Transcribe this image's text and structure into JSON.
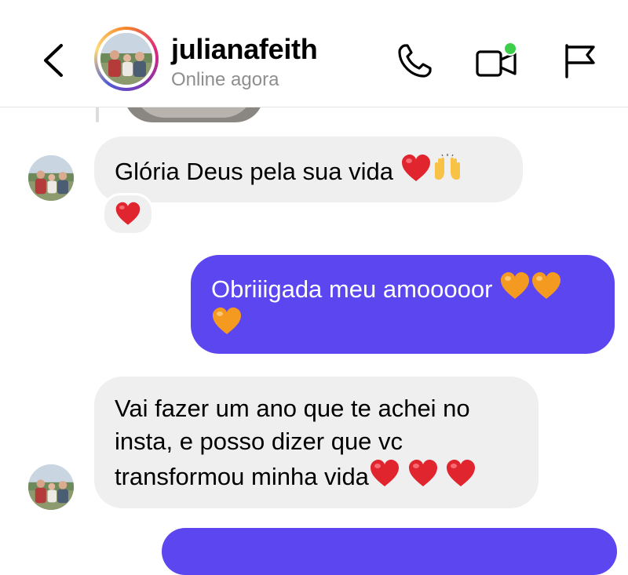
{
  "header": {
    "username": "julianafeith",
    "status": "Online agora",
    "icons": {
      "back": "back-chevron-icon",
      "call": "phone-icon",
      "video": "video-camera-icon",
      "report": "flag-icon"
    }
  },
  "messages": [
    {
      "direction": "incoming",
      "text": "Glória Deus pela sua vida",
      "emojis": [
        "red-heart",
        "raising-hands"
      ],
      "reaction": "red-heart"
    },
    {
      "direction": "outgoing",
      "text": "Obriiigada meu amooooor",
      "emojis": [
        "orange-heart",
        "orange-heart",
        "orange-heart"
      ]
    },
    {
      "direction": "incoming",
      "text_lines": [
        "Vai fazer um ano que te achei no",
        "insta, e posso dizer que vc",
        "transformou minha vida"
      ],
      "emojis": [
        "red-heart",
        "red-heart",
        "red-heart"
      ]
    }
  ],
  "colors": {
    "outgoing_bubble": "#5b46f0",
    "incoming_bubble": "#efefef",
    "online_dot": "#3ecf4a",
    "secondary_text": "#8e8e8e"
  }
}
